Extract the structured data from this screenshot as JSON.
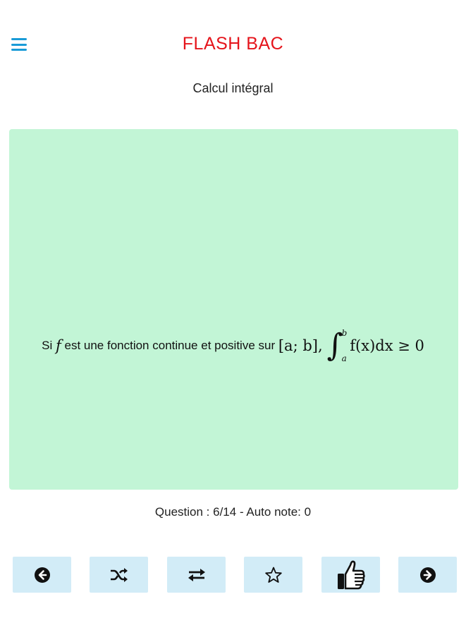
{
  "header": {
    "app_title": "FLASH BAC",
    "menu_icon": "hamburger-menu-icon"
  },
  "topic": "Calcul intégral",
  "card": {
    "prefix": "Si",
    "var_f": "f",
    "text_middle": "est une fonction continue et positive sur",
    "interval": "[a; b],",
    "upper_limit": "b",
    "lower_limit": "a",
    "integrand": "f(x)dx ≥ 0"
  },
  "status": "Question : 6/14 - Auto note: 0",
  "toolbar": {
    "buttons": [
      {
        "icon": "arrow-left-circle-icon"
      },
      {
        "icon": "shuffle-icon"
      },
      {
        "icon": "swap-arrows-icon"
      },
      {
        "icon": "star-outline-icon"
      },
      {
        "icon": "thumbs-up-icon"
      },
      {
        "icon": "arrow-right-circle-icon"
      }
    ]
  },
  "colors": {
    "title": "#e5141b",
    "menu": "#1a9bd7",
    "card_bg": "#c2f5d6",
    "button_bg": "#d2ecf7"
  }
}
